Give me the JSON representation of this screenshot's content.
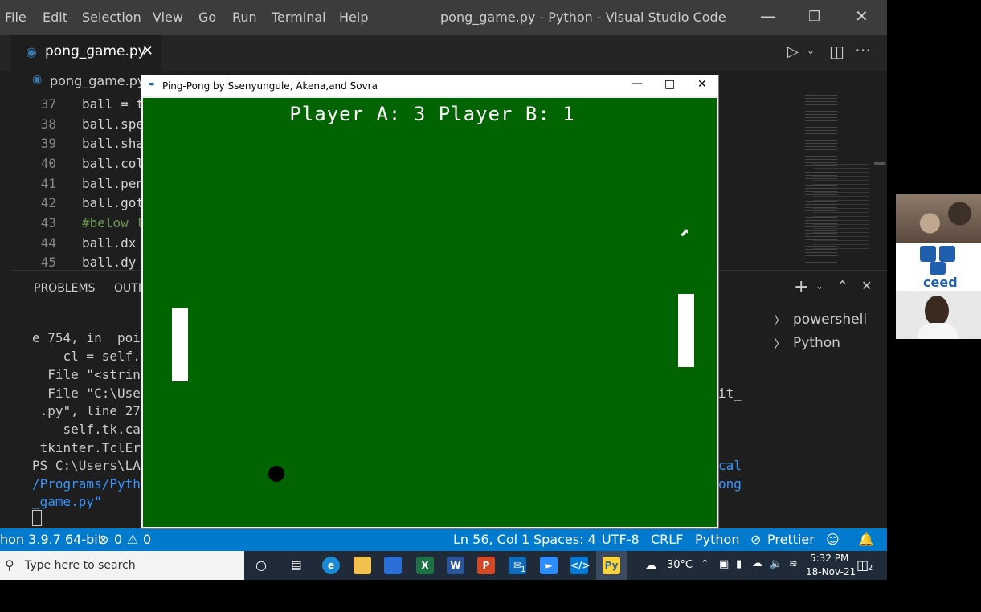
{
  "vscode": {
    "menu": [
      "File",
      "Edit",
      "Selection",
      "View",
      "Go",
      "Run",
      "Terminal",
      "Help"
    ],
    "window_title": "pong_game.py - Python - Visual Studio Code",
    "tab_label": "pong_game.py",
    "breadcrumb": "pong_game.py",
    "line_numbers": [
      "37",
      "38",
      "39",
      "40",
      "41",
      "42",
      "43",
      "44",
      "45"
    ],
    "code_lines": [
      "ball = t",
      "ball.spe",
      "ball.sha",
      "ball.col",
      "ball.pen",
      "ball.got",
      "#below l",
      "ball.dx",
      "ball.dy"
    ],
    "panel_tabs": [
      "PROBLEMS",
      "OUTI"
    ],
    "terminal_lines": [
      "e 754, in _poi",
      "    cl = self.",
      "  File \"<strin",
      "  File \"C:\\Use",
      "_.py\", line 27",
      "    self.tk.ca",
      "_tkinter.TclEr",
      "PS C:\\Users\\LA",
      "/Programs/Pyth",
      "_game.py\""
    ],
    "terminal_right": [
      "it_",
      "cal",
      "ong"
    ],
    "terminals": [
      "powershell",
      "Python"
    ],
    "status": {
      "interpreter": "hon 3.9.7 64-bit",
      "errors": "0",
      "warnings": "0",
      "position": "Ln 56, Col 1",
      "spaces": "Spaces: 4",
      "encoding": "UTF-8",
      "eol": "CRLF",
      "language": "Python",
      "formatter": "Prettier"
    }
  },
  "pong": {
    "title": "Ping-Pong by Ssenyungule, Akena,and Sovra",
    "score": "Player A: 3   Player B: 1",
    "background_color": "#006400"
  },
  "taskbar": {
    "search_placeholder": "Type here to search",
    "weather": "30°C",
    "time": "5:32 PM",
    "date": "18-Nov-21",
    "mail_badge": "1",
    "notification_count": "2",
    "apps": [
      "cortana-icon",
      "task-view-icon",
      "edge-icon",
      "file-explorer-icon",
      "store-icon",
      "excel-icon",
      "word-icon",
      "powerpoint-icon",
      "mail-icon",
      "zoom-icon",
      "vscode-icon",
      "python-icon"
    ]
  },
  "video": {
    "logo_text": "ceed"
  }
}
